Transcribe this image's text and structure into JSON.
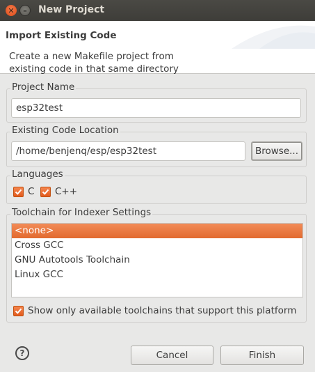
{
  "window": {
    "title": "New Project",
    "close_glyph": "✕",
    "minimize_glyph": "–"
  },
  "header": {
    "title": "Import Existing Code",
    "description_line1": "Create a new Makefile project from",
    "description_line2": "existing code in that same directory"
  },
  "project_name": {
    "label": "Project Name",
    "value": "esp32test"
  },
  "code_location": {
    "label": "Existing Code Location",
    "value": "/home/benjenq/esp/esp32test",
    "browse_label": "Browse..."
  },
  "languages": {
    "label": "Languages",
    "items": [
      {
        "label": "C",
        "checked": true
      },
      {
        "label": "C++",
        "checked": true
      }
    ]
  },
  "toolchain": {
    "label": "Toolchain for Indexer Settings",
    "items": [
      {
        "label": "<none>",
        "selected": true
      },
      {
        "label": "Cross GCC",
        "selected": false
      },
      {
        "label": "GNU Autotools Toolchain",
        "selected": false
      },
      {
        "label": "Linux GCC",
        "selected": false
      }
    ],
    "filter_label": "Show only available toolchains that support this platform",
    "filter_checked": true
  },
  "footer": {
    "help_glyph": "?",
    "cancel_label": "Cancel",
    "finish_label": "Finish"
  },
  "colors": {
    "accent": "#e86a30",
    "titlebar": "#3f3e3a",
    "dialog_bg": "#e8e8e7"
  },
  "icons": {
    "close": "close-icon",
    "minimize": "minimize-icon",
    "check": "check-icon",
    "help": "help-icon"
  }
}
